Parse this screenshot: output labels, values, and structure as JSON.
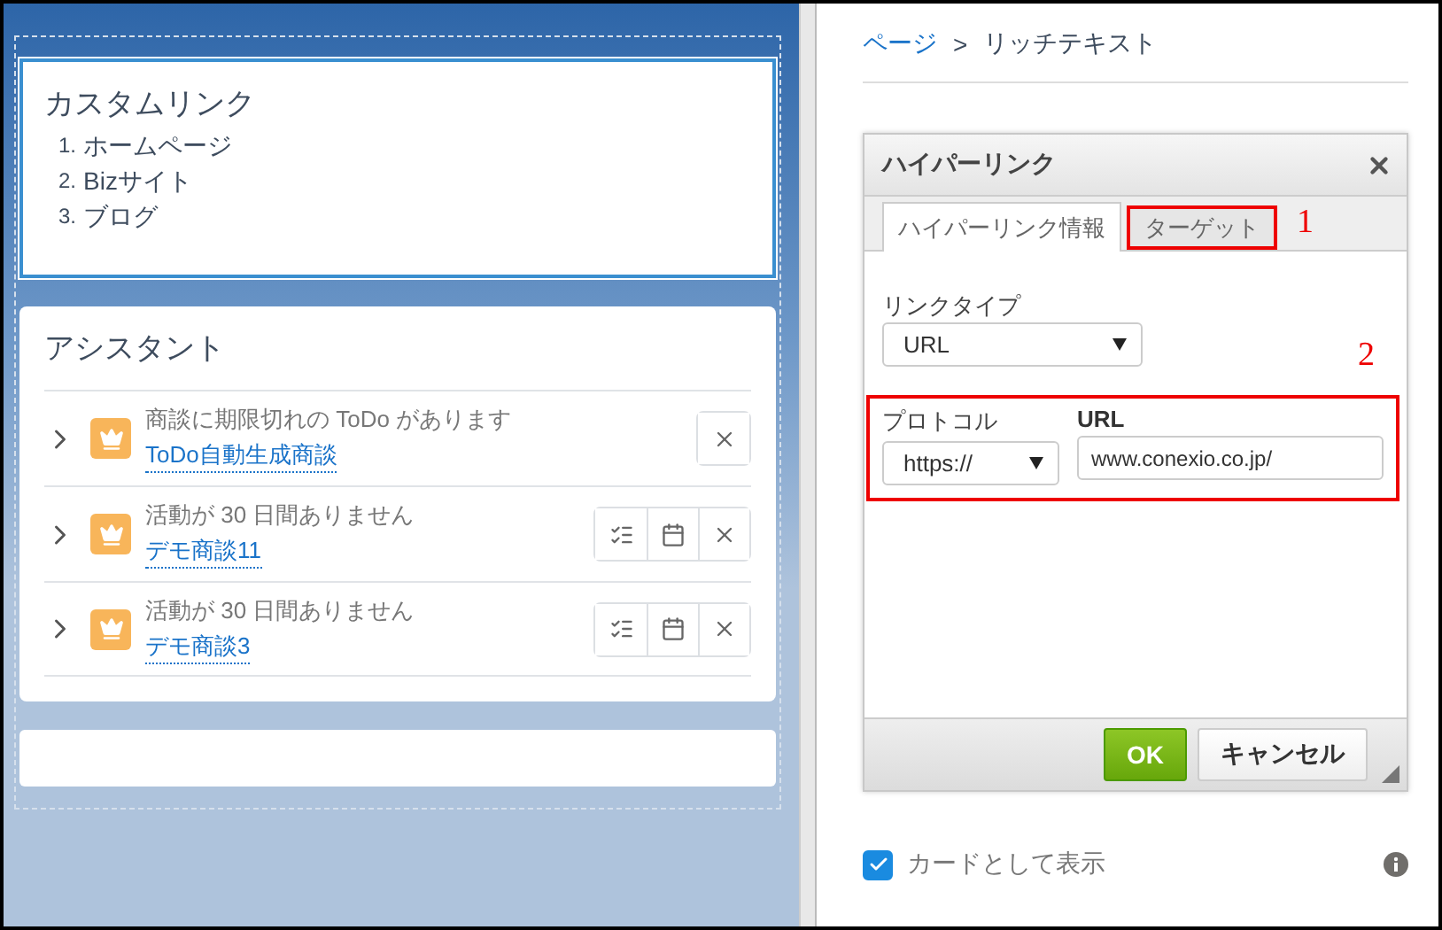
{
  "custom_links": {
    "title": "カスタムリンク",
    "items": [
      {
        "number": "1.",
        "label": "ホームページ"
      },
      {
        "number": "2.",
        "label": "Bizサイト"
      },
      {
        "number": "3.",
        "label": "ブログ"
      }
    ]
  },
  "assistant": {
    "title": "アシスタント",
    "items": [
      {
        "message": "商談に期限切れの ToDo があります",
        "link": "ToDo自動生成商談",
        "actions": [
          {
            "kind": "close"
          }
        ]
      },
      {
        "message": "活動が 30 日間ありません",
        "link": "デモ商談11",
        "actions": [
          {
            "kind": "tasks"
          },
          {
            "kind": "calendar"
          },
          {
            "kind": "close"
          }
        ]
      },
      {
        "message": "活動が 30 日間ありません",
        "link": "デモ商談3",
        "actions": [
          {
            "kind": "tasks"
          },
          {
            "kind": "calendar"
          },
          {
            "kind": "close"
          }
        ]
      }
    ]
  },
  "breadcrumb": {
    "parent": "ページ",
    "separator": ">",
    "current": "リッチテキスト"
  },
  "dialog": {
    "title": "ハイパーリンク",
    "tabs": [
      {
        "label": "ハイパーリンク情報",
        "selected": true,
        "highlighted": false
      },
      {
        "label": "ターゲット",
        "selected": false,
        "highlighted": true,
        "marker": "1"
      }
    ],
    "link_type": {
      "label": "リンクタイプ",
      "value": "URL"
    },
    "protocol_group": {
      "highlighted": true,
      "marker": "2",
      "protocol": {
        "label": "プロトコル",
        "value": "https://"
      },
      "url": {
        "label": "URL",
        "value": "www.conexio.co.jp/"
      }
    },
    "buttons": [
      {
        "label": "OK",
        "kind": "primary"
      },
      {
        "label": "キャンセル",
        "kind": "secondary"
      }
    ]
  },
  "display_as_card": {
    "label": "カードとして表示",
    "checked": true
  }
}
